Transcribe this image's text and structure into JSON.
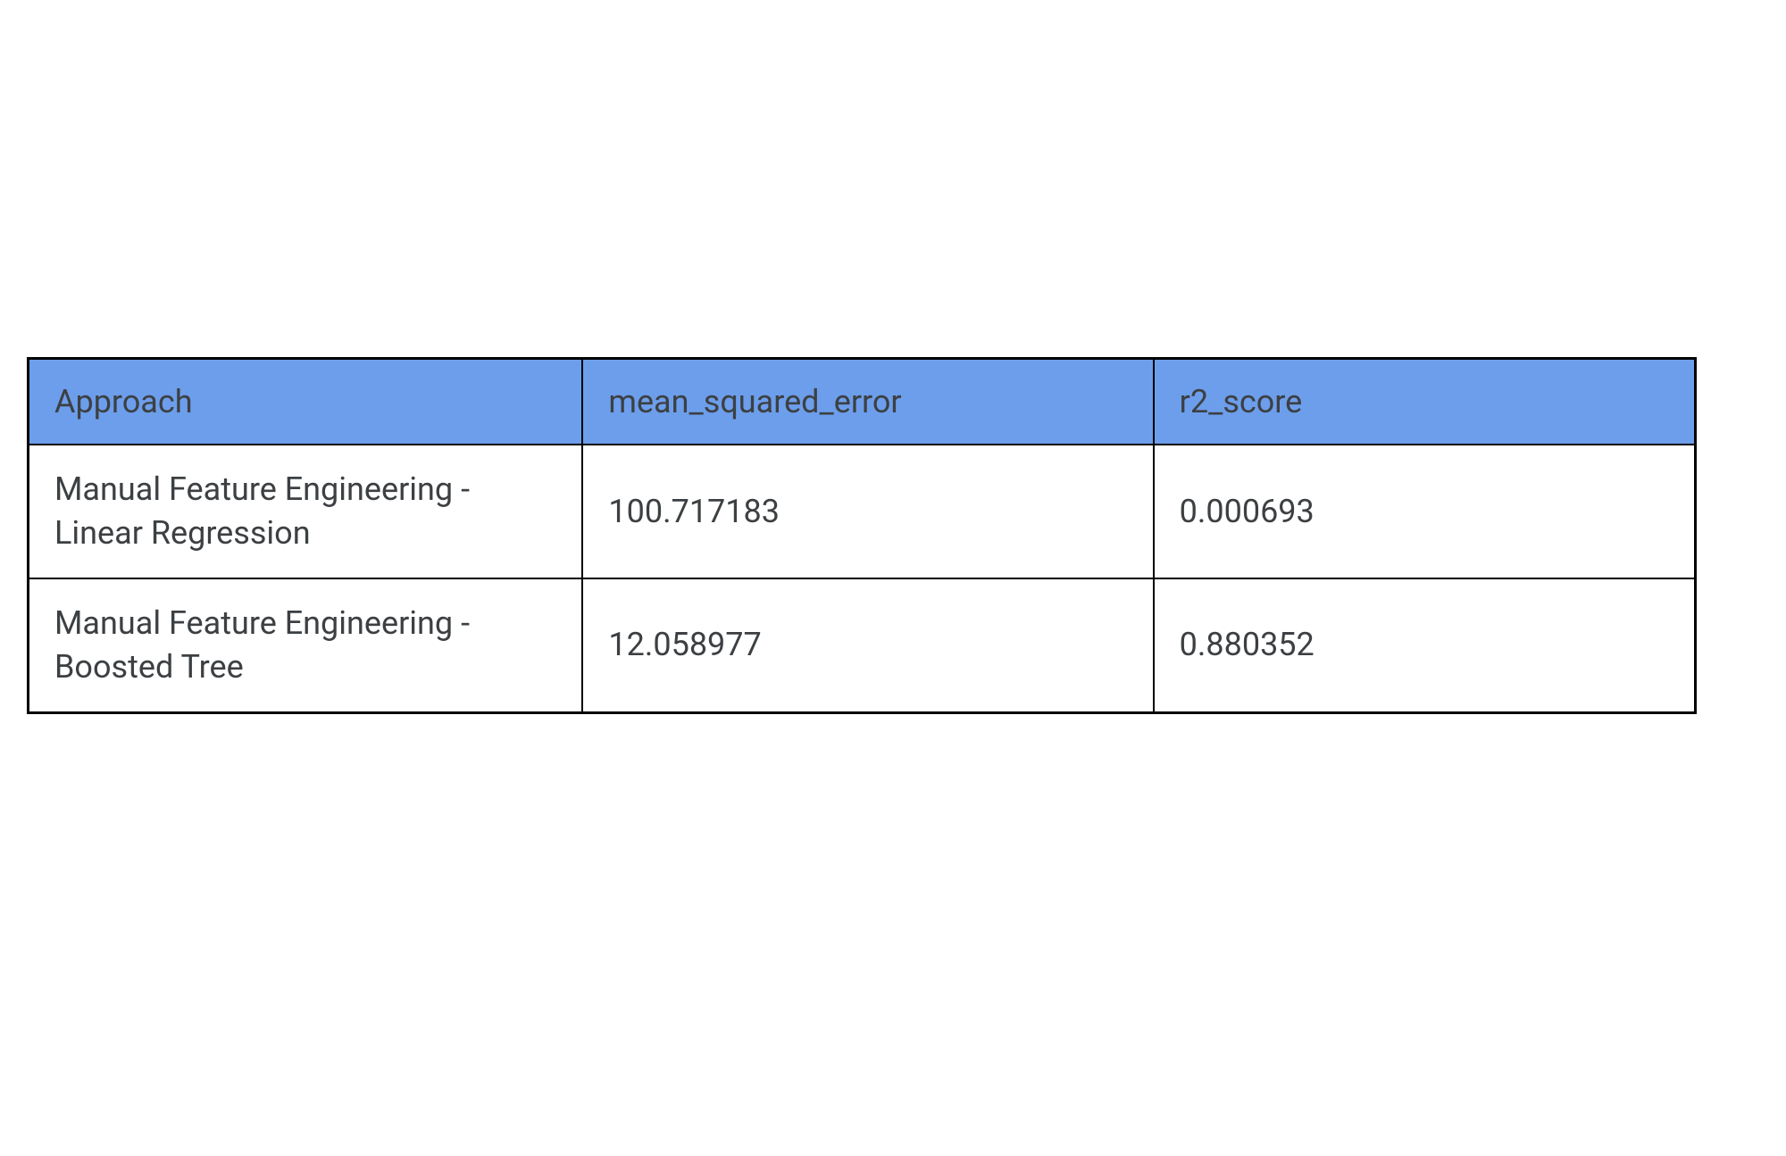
{
  "chart_data": {
    "type": "table",
    "headers": [
      "Approach",
      "mean_squared_error",
      "r2_score"
    ],
    "rows": [
      {
        "approach": "Manual Feature Engineering - Linear Regression",
        "mean_squared_error": "100.717183",
        "r2_score": "0.000693"
      },
      {
        "approach": "Manual Feature Engineering - Boosted Tree",
        "mean_squared_error": "12.058977",
        "r2_score": "0.880352"
      }
    ]
  }
}
